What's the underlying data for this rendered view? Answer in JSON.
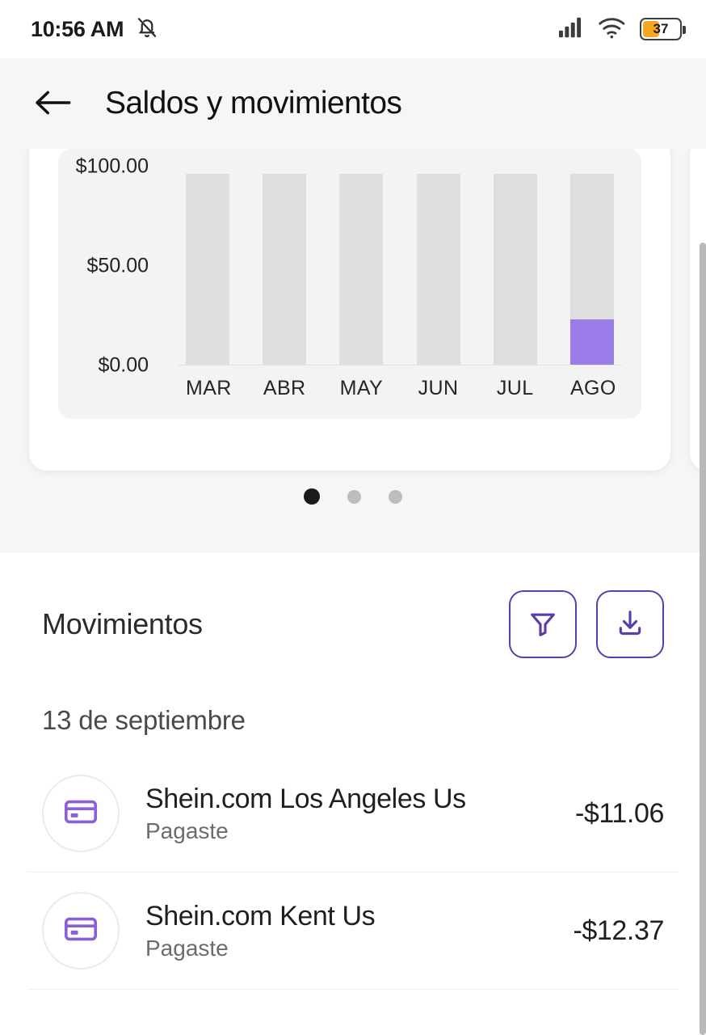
{
  "status_bar": {
    "time": "10:56 AM",
    "mute_icon": "bell-muted-icon",
    "signal_icon": "cellular-signal-icon",
    "wifi_icon": "wifi-icon",
    "battery_percent": "37",
    "battery_color": "#f5a623"
  },
  "header": {
    "back_icon": "arrow-left-icon",
    "title": "Saldos y movimientos"
  },
  "chart_data": {
    "type": "bar",
    "title": "",
    "xlabel": "",
    "ylabel": "",
    "categories": [
      "MAR",
      "ABR",
      "MAY",
      "JUN",
      "JUL",
      "AGO"
    ],
    "values": [
      0,
      0,
      0,
      0,
      0,
      28
    ],
    "track_max": 118,
    "ylim": [
      0,
      100
    ],
    "yticks": [
      "$0.00",
      "$50.00",
      "$100.00"
    ],
    "ytick_values": [
      0,
      50,
      100
    ],
    "grid": false,
    "legend": "none",
    "bar_fill_color": "#9c7ce8",
    "bar_track_color": "#dedede"
  },
  "carousel": {
    "dots": [
      {
        "label": "page-1",
        "active": true
      },
      {
        "label": "page-2",
        "active": false
      },
      {
        "label": "page-3",
        "active": false
      }
    ]
  },
  "movements": {
    "title": "Movimientos",
    "filter_icon": "filter-funnel-icon",
    "download_icon": "download-icon",
    "accent_color": "#5b3ea8",
    "date_group": "13 de septiembre",
    "transactions": [
      {
        "icon": "credit-card-icon",
        "name": "Shein.com Los Angeles Us",
        "status": "Pagaste",
        "amount": "-$11.06"
      },
      {
        "icon": "credit-card-icon",
        "name": "Shein.com Kent Us",
        "status": "Pagaste",
        "amount": "-$12.37"
      }
    ]
  }
}
